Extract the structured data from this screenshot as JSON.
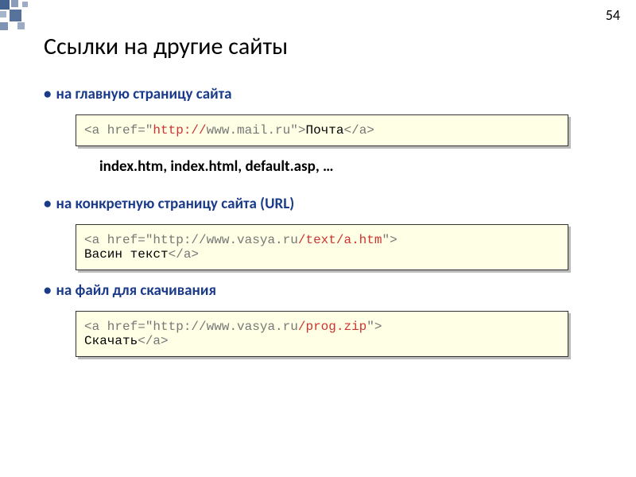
{
  "slideNumber": "54",
  "title": "Ссылки на другие сайты",
  "bullet1": {
    "label": "на главную страницу сайта",
    "code": {
      "p1": "<a href=\"",
      "p2": "http://",
      "p3": "www.mail.ru",
      "p4": "\">",
      "p5": "Почта",
      "p6": "</a>"
    },
    "note": "index.htm, index.html, default.asp, …"
  },
  "bullet2": {
    "label": "на конкретную страницу сайта (URL)",
    "code": {
      "p1": "<a href=\"",
      "p2": "http://www.vasya.ru",
      "p3": "/text/a.htm",
      "p4": "\">",
      "p5": "Васин текст",
      "p6": "</a>"
    }
  },
  "bullet3": {
    "label": "на файл для скачивания",
    "code": {
      "p1": "<a href=\"",
      "p2": "http://www.vasya.ru",
      "p3": "/prog.zip",
      "p4": "\">",
      "p5": "Скачать",
      "p6": "</a>"
    }
  }
}
